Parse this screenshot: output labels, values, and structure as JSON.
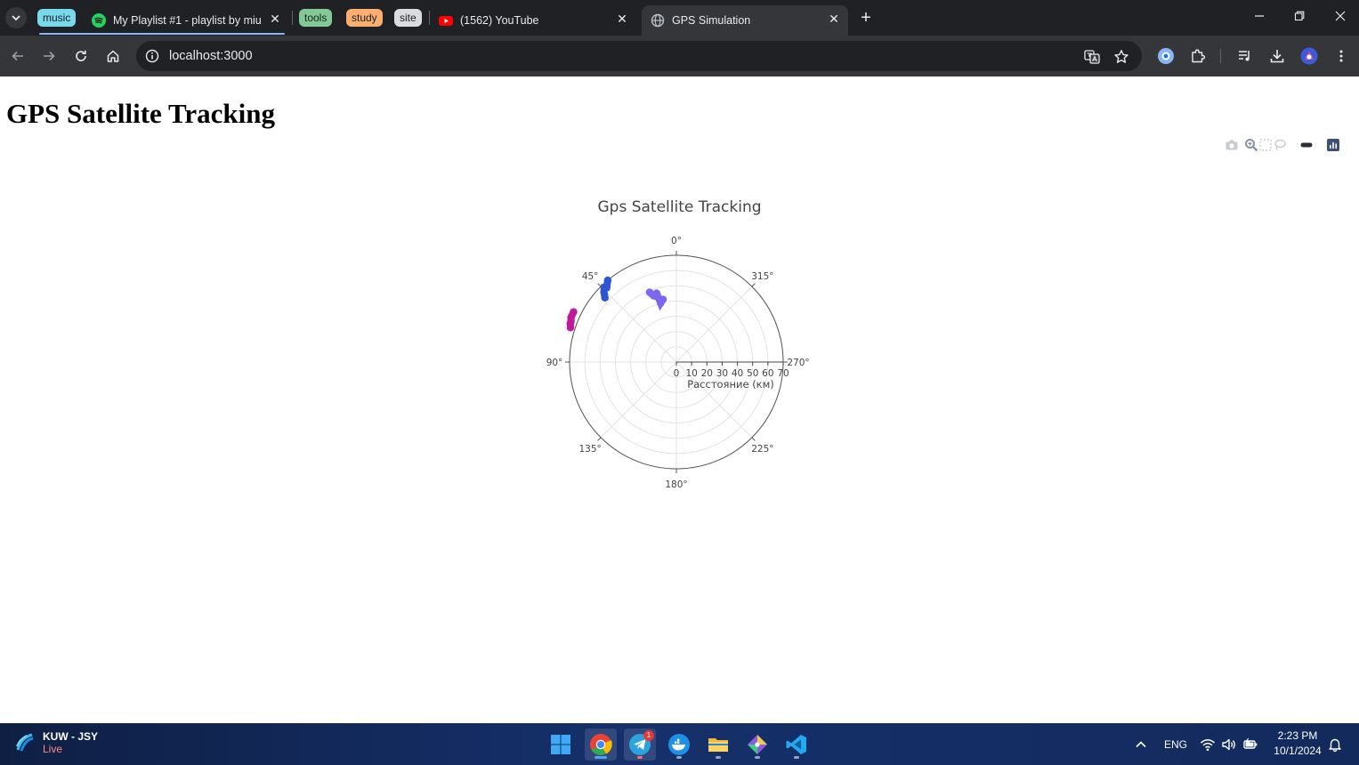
{
  "browser": {
    "tab_groups": [
      {
        "label": "music",
        "color": "#78d9ec"
      },
      {
        "label": "tools",
        "color": "#81c995"
      },
      {
        "label": "study",
        "color": "#fcad70"
      },
      {
        "label": "site",
        "color": "#dadce0"
      }
    ],
    "tabs": [
      {
        "title": "My Playlist #1 - playlist by miu |",
        "icon": "spotify-icon"
      },
      {
        "title": "(1562) YouTube",
        "icon": "youtube-icon"
      },
      {
        "title": "GPS Simulation",
        "icon": "globe-icon",
        "active": true
      }
    ],
    "address": "localhost:3000"
  },
  "page": {
    "title": "GPS Satellite Tracking"
  },
  "chart_data": {
    "type": "scatter",
    "subtype": "polar",
    "title": "Gps Satellite Tracking",
    "radial_axis": {
      "title": "Расстояние (км)",
      "range": [
        0,
        70
      ],
      "ticks": [
        0,
        10,
        20,
        30,
        40,
        50,
        60,
        70
      ]
    },
    "angular_axis": {
      "direction": "clockwise-counter",
      "rotation": 90,
      "tick_labels": [
        "0°",
        "45°",
        "90°",
        "135°",
        "180°",
        "225°",
        "270°",
        "315°"
      ]
    },
    "series": [
      {
        "color": "#7b68ee",
        "points": [
          {
            "angle": 19,
            "r": 46
          },
          {
            "angle": 15,
            "r": 40
          },
          {
            "angle": 12,
            "r": 42
          },
          {
            "angle": 16,
            "r": 47
          },
          {
            "angle": 21,
            "r": 49
          },
          {
            "angle": 17,
            "r": 45
          }
        ]
      },
      {
        "color": "#2e55d6",
        "points": [
          {
            "angle": 46,
            "r": 66
          },
          {
            "angle": 40,
            "r": 70
          },
          {
            "angle": 43,
            "r": 67
          },
          {
            "angle": 48,
            "r": 63
          },
          {
            "angle": 44,
            "r": 68
          }
        ]
      },
      {
        "color": "#c2189a",
        "points": [
          {
            "angle": 72,
            "r": 73
          },
          {
            "angle": 67,
            "r": 75
          },
          {
            "angle": 69,
            "r": 74
          },
          {
            "angle": 64,
            "r": 75
          },
          {
            "angle": 70,
            "r": 74
          }
        ]
      }
    ]
  },
  "taskbar": {
    "weather_title": "KUW - JSY",
    "weather_status": "Live",
    "lang": "ENG",
    "time": "2:23 PM",
    "date": "10/1/2024",
    "telegram_badge": "1"
  }
}
